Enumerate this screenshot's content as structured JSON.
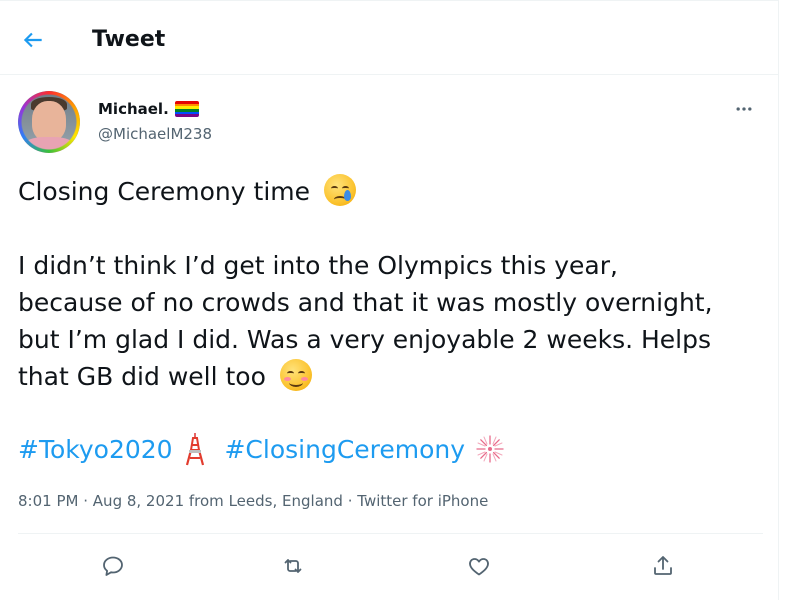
{
  "header": {
    "title": "Tweet",
    "back_icon": "arrow-left-icon"
  },
  "author": {
    "display_name": "Michael.",
    "handle": "@MichaelM238",
    "flag_icon": "rainbow-flag-icon",
    "flag_colors": [
      "#e40303",
      "#ff8c00",
      "#ffed00",
      "#008026",
      "#004dff",
      "#750787"
    ]
  },
  "tweet": {
    "line1": "Closing Ceremony time",
    "paragraph2_lines": [
      "I didn’t think I’d get into the Olympics this year,",
      "because of no crowds and that it was mostly overnight,",
      "but I’m glad I did. Was a very enjoyable 2 weeks. Helps",
      "that GB did well too"
    ],
    "hashtags": [
      "#Tokyo2020",
      "#ClosingCeremony"
    ],
    "emoji": [
      "crying-face-emoji",
      "smiling-blushing-face-emoji",
      "tokyo-tower-emoji",
      "firework-emoji"
    ]
  },
  "meta": {
    "time": "8:01 PM",
    "date": "Aug 8, 2021",
    "from_label": "from",
    "location": "Leeds, England",
    "separator": "·",
    "source": "Twitter for iPhone"
  },
  "actions": {
    "icons": [
      "reply-icon",
      "retweet-icon",
      "like-icon",
      "share-icon"
    ]
  },
  "colors": {
    "accent": "#1d9bf0",
    "text_primary": "#0f1419",
    "text_secondary": "#536471",
    "border": "#eff3f4"
  }
}
